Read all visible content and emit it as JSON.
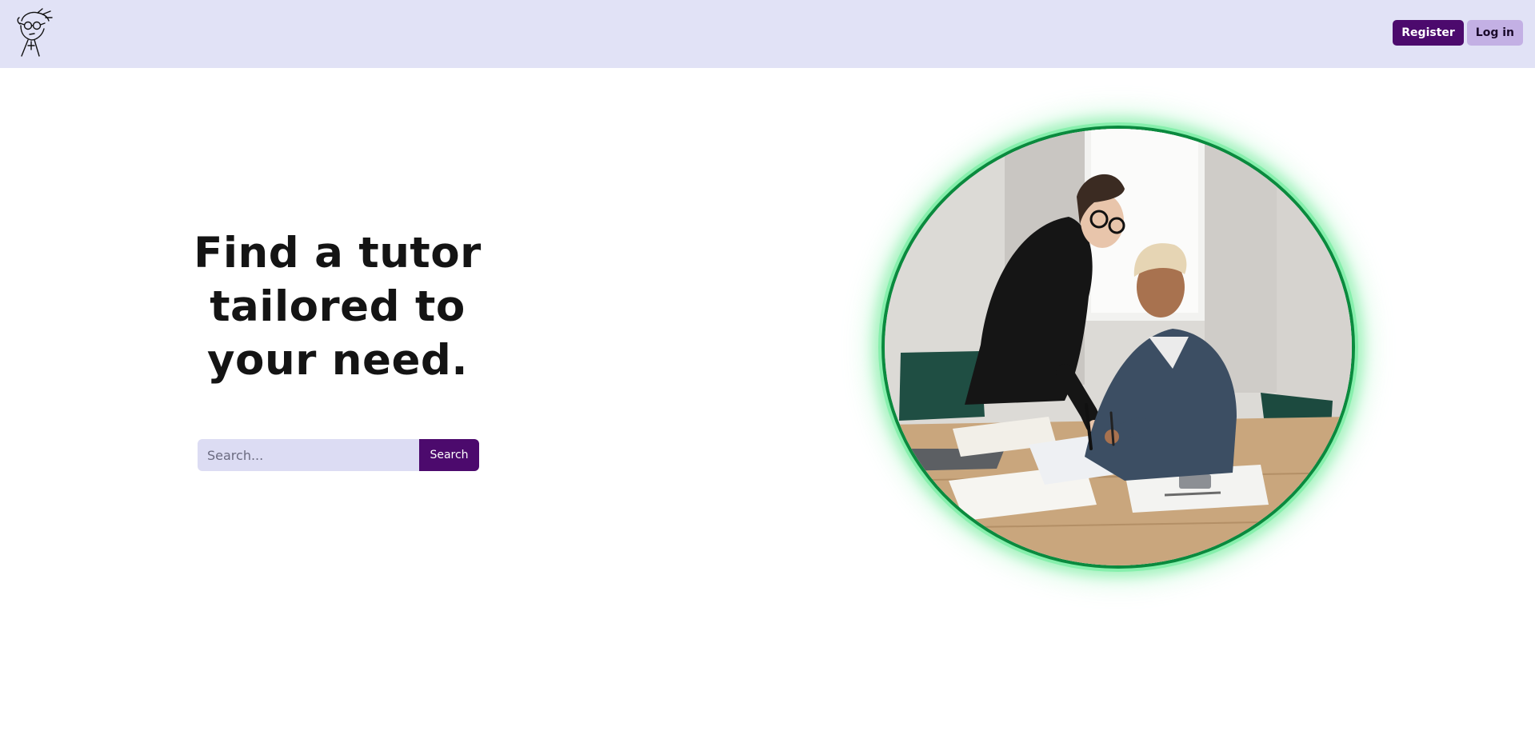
{
  "nav": {
    "logo_icon": "sketch-avatar-logo",
    "register_label": "Register",
    "login_label": "Log in"
  },
  "hero": {
    "title": "Find a tutor tailored to your need.",
    "search": {
      "placeholder": "Search...",
      "value": "",
      "button_label": "Search"
    },
    "image_icon": "tutor-student-photo"
  },
  "colors": {
    "nav_background": "#e1e2f6",
    "primary": "#4c0a6d",
    "secondary": "#c3b0e4",
    "search_input_background": "#dcdcf3",
    "image_ring": "#0a8a3e",
    "image_glow": "#86efac",
    "text": "#141414"
  }
}
